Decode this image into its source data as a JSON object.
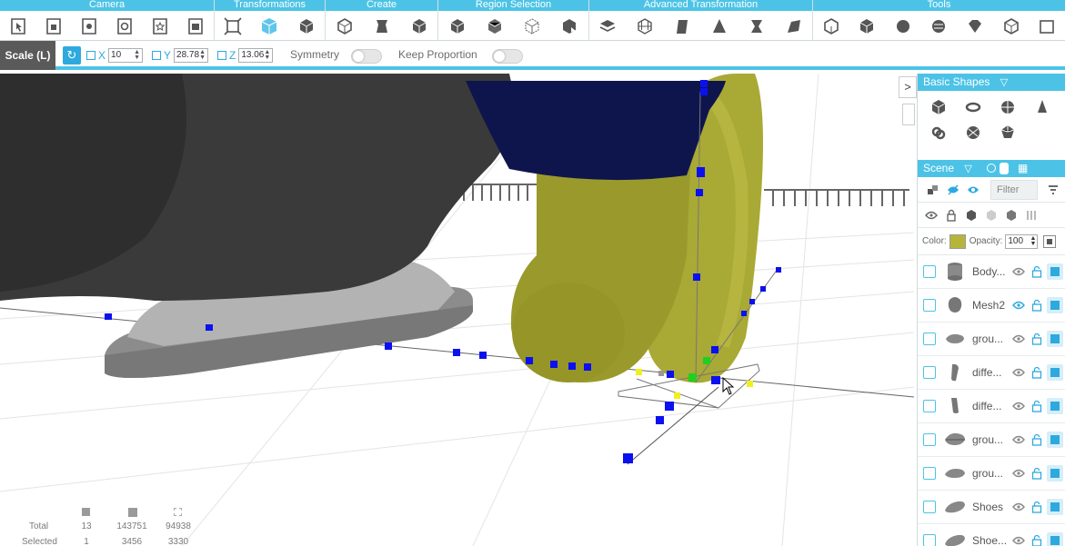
{
  "toolbar": {
    "groups": [
      {
        "title": "Camera"
      },
      {
        "title": "Transformations"
      },
      {
        "title": "Create"
      },
      {
        "title": "Region Selection"
      },
      {
        "title": "Advanced Transformation"
      },
      {
        "title": "Tools"
      }
    ]
  },
  "options": {
    "mode_label": "Scale (L)",
    "x_label": "X",
    "x_value": "10",
    "y_label": "Y",
    "y_value": "28.78",
    "z_label": "Z",
    "z_value": "13.06",
    "symmetry_label": "Symmetry",
    "keep_proportion_label": "Keep Proportion"
  },
  "stats": {
    "total_label": "Total",
    "selected_label": "Selected",
    "total": [
      "13",
      "143751",
      "94938"
    ],
    "selected": [
      "1",
      "3456",
      "3330"
    ]
  },
  "panel": {
    "basic_shapes_title": "Basic Shapes",
    "scene_title": "Scene",
    "filter_placeholder": "Filter",
    "color_label": "Color:",
    "color_value": "#b6b53a",
    "opacity_label": "Opacity:",
    "opacity_value": "100",
    "items": [
      {
        "name": "Body..."
      },
      {
        "name": "Mesh2"
      },
      {
        "name": "grou..."
      },
      {
        "name": "diffe..."
      },
      {
        "name": "diffe..."
      },
      {
        "name": "grou..."
      },
      {
        "name": "grou..."
      },
      {
        "name": "Shoes"
      },
      {
        "name": "Shoe..."
      }
    ]
  },
  "colors": {
    "accent": "#4cc3e6",
    "accent_dark": "#2ea9de"
  }
}
